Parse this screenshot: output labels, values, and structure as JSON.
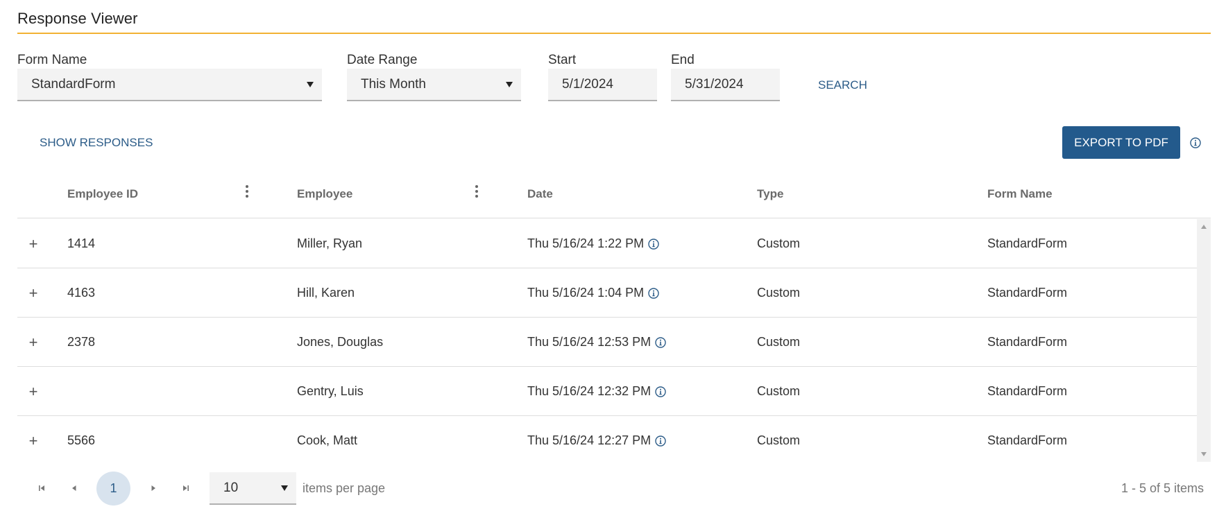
{
  "header": {
    "title": "Response Viewer"
  },
  "filters": {
    "form_name_label": "Form Name",
    "form_name_value": "StandardForm",
    "date_range_label": "Date Range",
    "date_range_value": "This Month",
    "start_label": "Start",
    "start_value": "5/1/2024",
    "end_label": "End",
    "end_value": "5/31/2024",
    "search_label": "SEARCH"
  },
  "toolbar": {
    "show_responses_label": "SHOW RESPONSES",
    "export_label": "EXPORT TO PDF"
  },
  "grid": {
    "columns": [
      "Employee ID",
      "Employee",
      "Date",
      "Type",
      "Form Name"
    ],
    "rows": [
      {
        "expand": "+",
        "employee_id": "1414",
        "employee": "Miller, Ryan",
        "date": "Thu 5/16/24 1:22 PM",
        "type": "Custom",
        "form_name": "StandardForm"
      },
      {
        "expand": "+",
        "employee_id": "4163",
        "employee": "Hill, Karen",
        "date": "Thu 5/16/24 1:04 PM",
        "type": "Custom",
        "form_name": "StandardForm"
      },
      {
        "expand": "+",
        "employee_id": "2378",
        "employee": "Jones, Douglas",
        "date": "Thu 5/16/24 12:53 PM",
        "type": "Custom",
        "form_name": "StandardForm"
      },
      {
        "expand": "+",
        "employee_id": "",
        "employee": "Gentry, Luis",
        "date": "Thu 5/16/24 12:32 PM",
        "type": "Custom",
        "form_name": "StandardForm"
      },
      {
        "expand": "+",
        "employee_id": "5566",
        "employee": "Cook, Matt",
        "date": "Thu 5/16/24 12:27 PM",
        "type": "Custom",
        "form_name": "StandardForm"
      }
    ]
  },
  "pager": {
    "current_page": "1",
    "page_size": "10",
    "per_page_label": "items per page",
    "summary": "1 - 5 of 5 items"
  },
  "icons": {
    "info": "info-circle-icon",
    "kebab": "more-vertical-icon",
    "first": "first-page-icon",
    "prev": "previous-page-icon",
    "next": "next-page-icon",
    "last": "last-page-icon",
    "caret": "caret-down-icon",
    "expand": "plus-icon"
  },
  "colors": {
    "accent_rule": "#f2b233",
    "primary": "#235a8c",
    "link": "#2c5c88",
    "page_active_bg": "#d8e3ee"
  }
}
